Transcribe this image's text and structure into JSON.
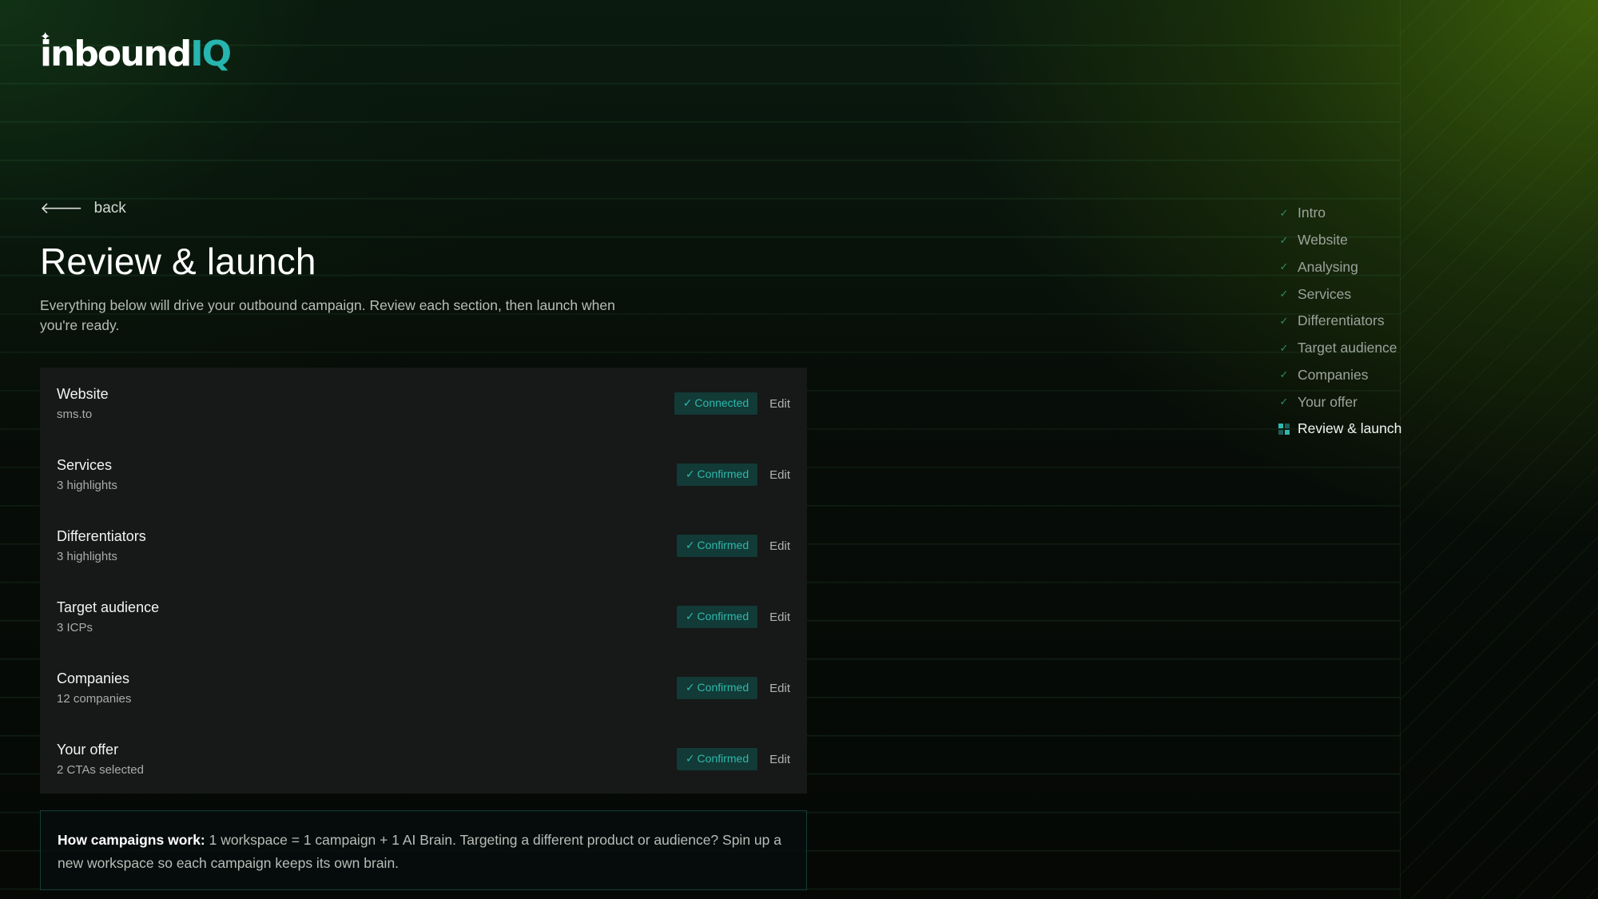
{
  "brand": {
    "logo_main": "inbound",
    "logo_accent": "IQ",
    "accent_color": "#27b5b0"
  },
  "nav": {
    "back_label": "back",
    "back_icon": "arrow-left-icon"
  },
  "page": {
    "title": "Review & launch",
    "subtitle": "Everything below will drive your outbound campaign. Review each section, then launch when you're ready."
  },
  "sections": [
    {
      "name": "Website",
      "detail": "sms.to",
      "status": "Connected",
      "edit_label": "Edit"
    },
    {
      "name": "Services",
      "detail": "3 highlights",
      "status": "Confirmed",
      "edit_label": "Edit"
    },
    {
      "name": "Differentiators",
      "detail": "3 highlights",
      "status": "Confirmed",
      "edit_label": "Edit"
    },
    {
      "name": "Target audience",
      "detail": "3 ICPs",
      "status": "Confirmed",
      "edit_label": "Edit"
    },
    {
      "name": "Companies",
      "detail": "12 companies",
      "status": "Confirmed",
      "edit_label": "Edit"
    },
    {
      "name": "Your offer",
      "detail": "2 CTAs selected",
      "status": "Confirmed",
      "edit_label": "Edit"
    }
  ],
  "status_check": "✓",
  "info": {
    "heading": "How campaigns work:",
    "body": " 1 workspace = 1 campaign + 1 AI Brain. Targeting a different product or audience? Spin up a new workspace so each campaign keeps its own brain."
  },
  "steps": {
    "check_glyph": "✓",
    "items": [
      {
        "label": "Intro",
        "state": "done"
      },
      {
        "label": "Website",
        "state": "done"
      },
      {
        "label": "Analysing",
        "state": "done"
      },
      {
        "label": "Services",
        "state": "done"
      },
      {
        "label": "Differentiators",
        "state": "done"
      },
      {
        "label": "Target audience",
        "state": "done"
      },
      {
        "label": "Companies",
        "state": "done"
      },
      {
        "label": "Your offer",
        "state": "done"
      },
      {
        "label": "Review & launch",
        "state": "current"
      }
    ]
  }
}
